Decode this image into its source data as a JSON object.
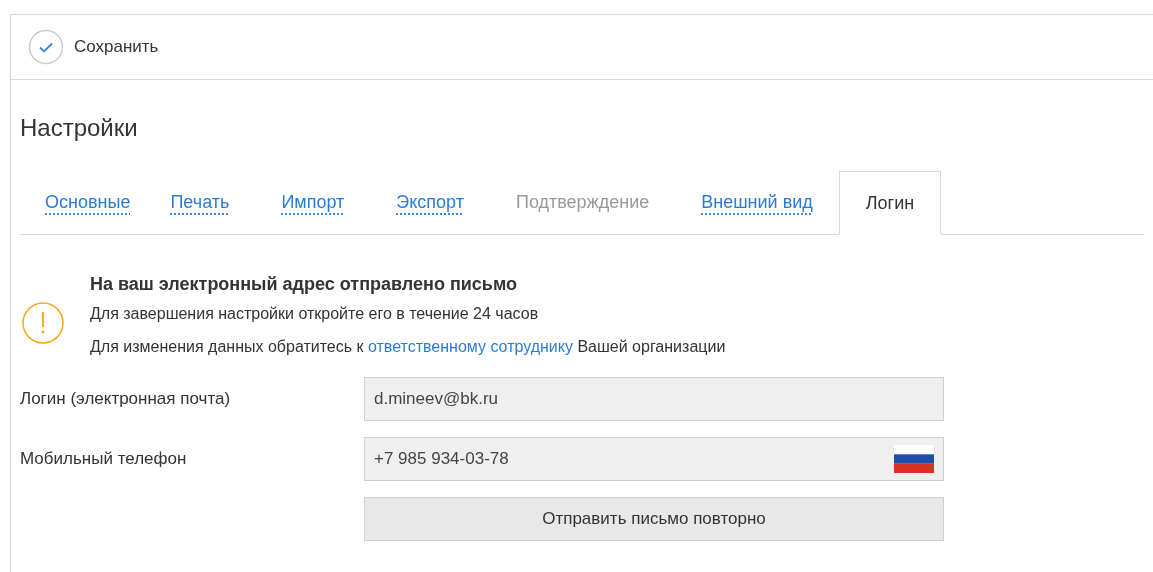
{
  "toolbar": {
    "save_button": "Сохранить"
  },
  "page_title": "Настройки",
  "tabs": [
    {
      "label": "Основные",
      "selected": false,
      "disabled": false
    },
    {
      "label": "Печать",
      "selected": false,
      "disabled": false
    },
    {
      "label": "Импорт",
      "selected": false,
      "disabled": false
    },
    {
      "label": "Экспорт",
      "selected": false,
      "disabled": false
    },
    {
      "label": "Подтверждение",
      "selected": false,
      "disabled": true
    },
    {
      "label": "Внешний вид",
      "selected": false,
      "disabled": false
    },
    {
      "label": "Логин",
      "selected": true,
      "disabled": false
    }
  ],
  "notice": {
    "title": "На ваш электронный адрес отправлено письмо",
    "line_1": "Для завершения настройки откройте его в течение 24 часов",
    "line_2_before": "Для изменения данных обратитесь к",
    "line_2_link": "ответственному сотруднику",
    "line_2_after": "Вашей организации"
  },
  "fields": [
    {
      "label": "Логин (электронная почта)",
      "value": "d.mineev@bk.ru",
      "kind": "text"
    },
    {
      "label": "Мобильный телефон",
      "value": "+7 985 934-03-78",
      "kind": "phone"
    }
  ],
  "resend_button": "Отправить письмо повторно"
}
